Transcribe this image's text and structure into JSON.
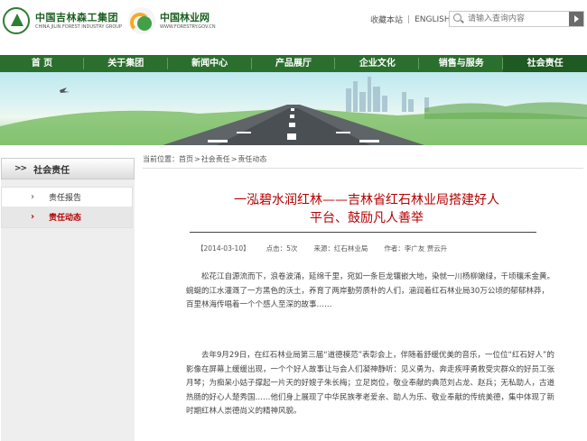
{
  "header": {
    "logo_cn": "中国吉林森工集团",
    "logo_en": "CHINA JILIN FOREST INDUSTRY GROUP",
    "logo2_cn": "中国林业网",
    "logo2_en": "WWW.FORESTRY.GOV.CN",
    "bookmark": "收藏本站",
    "english": "ENGLISH",
    "search_placeholder": "请输入查询内容"
  },
  "nav": {
    "items": [
      "首 页",
      "关于集团",
      "新闻中心",
      "产品展厅",
      "企业文化",
      "销售与服务",
      "社会责任"
    ],
    "active": 6
  },
  "sidebar": {
    "title": "社会责任",
    "arrows": ">>",
    "items": [
      "责任报告",
      "责任动态"
    ],
    "active": 1
  },
  "breadcrumb": {
    "prefix": "当前位置：",
    "items": [
      "首页",
      "社会责任",
      "责任动态"
    ],
    "sep": ">"
  },
  "article": {
    "title_line1": "一泓碧水润红林——吉林省红石林业局搭建好人",
    "title_line2": "平台、鼓励凡人善举",
    "date": "【2014-03-10】",
    "clicks": "点击：5次",
    "source": "来源：红石林业局",
    "author": "作者：李广友 贾云升",
    "paragraphs": [
      "松花江自源流而下，浪卷波涌，延绵千里，宛如一条巨龙镶嵌大地，染就一川杨柳嫩绿，千顷穰禾金黄。蜿蜒的江水灌溉了一方黑色的沃土，养育了两岸勤劳质朴的人们，涵润着红石林业局30万公顷的郁郁林莽，百里林海传唱着一个个感人至深的故事……",
      "去年9月29日，在红石林业局第三届“道德模范”表彰会上，伴随着舒缓优美的音乐，一位位“红石好人”的影像在屏幕上缓缓出现，一个个好人故事让与会人们凝神静听：见义勇为、奔走疾呼勇救受灾群众的好员工张月琴；为痴呆小姑子撑起一片天的好嫂子朱长梅；立足岗位，敬业奉献的典范刘占龙、赵兵；无私助人，古道热肠的好心人楚秀国……他们身上展现了中华民族孝老爱亲、助人为乐、敬业奉献的传统美德，集中体现了新时期红林人崇德尚义的精神风貌。"
    ]
  },
  "colors": {
    "nav_green": "#2b6f2e",
    "title_red": "#b40000"
  }
}
